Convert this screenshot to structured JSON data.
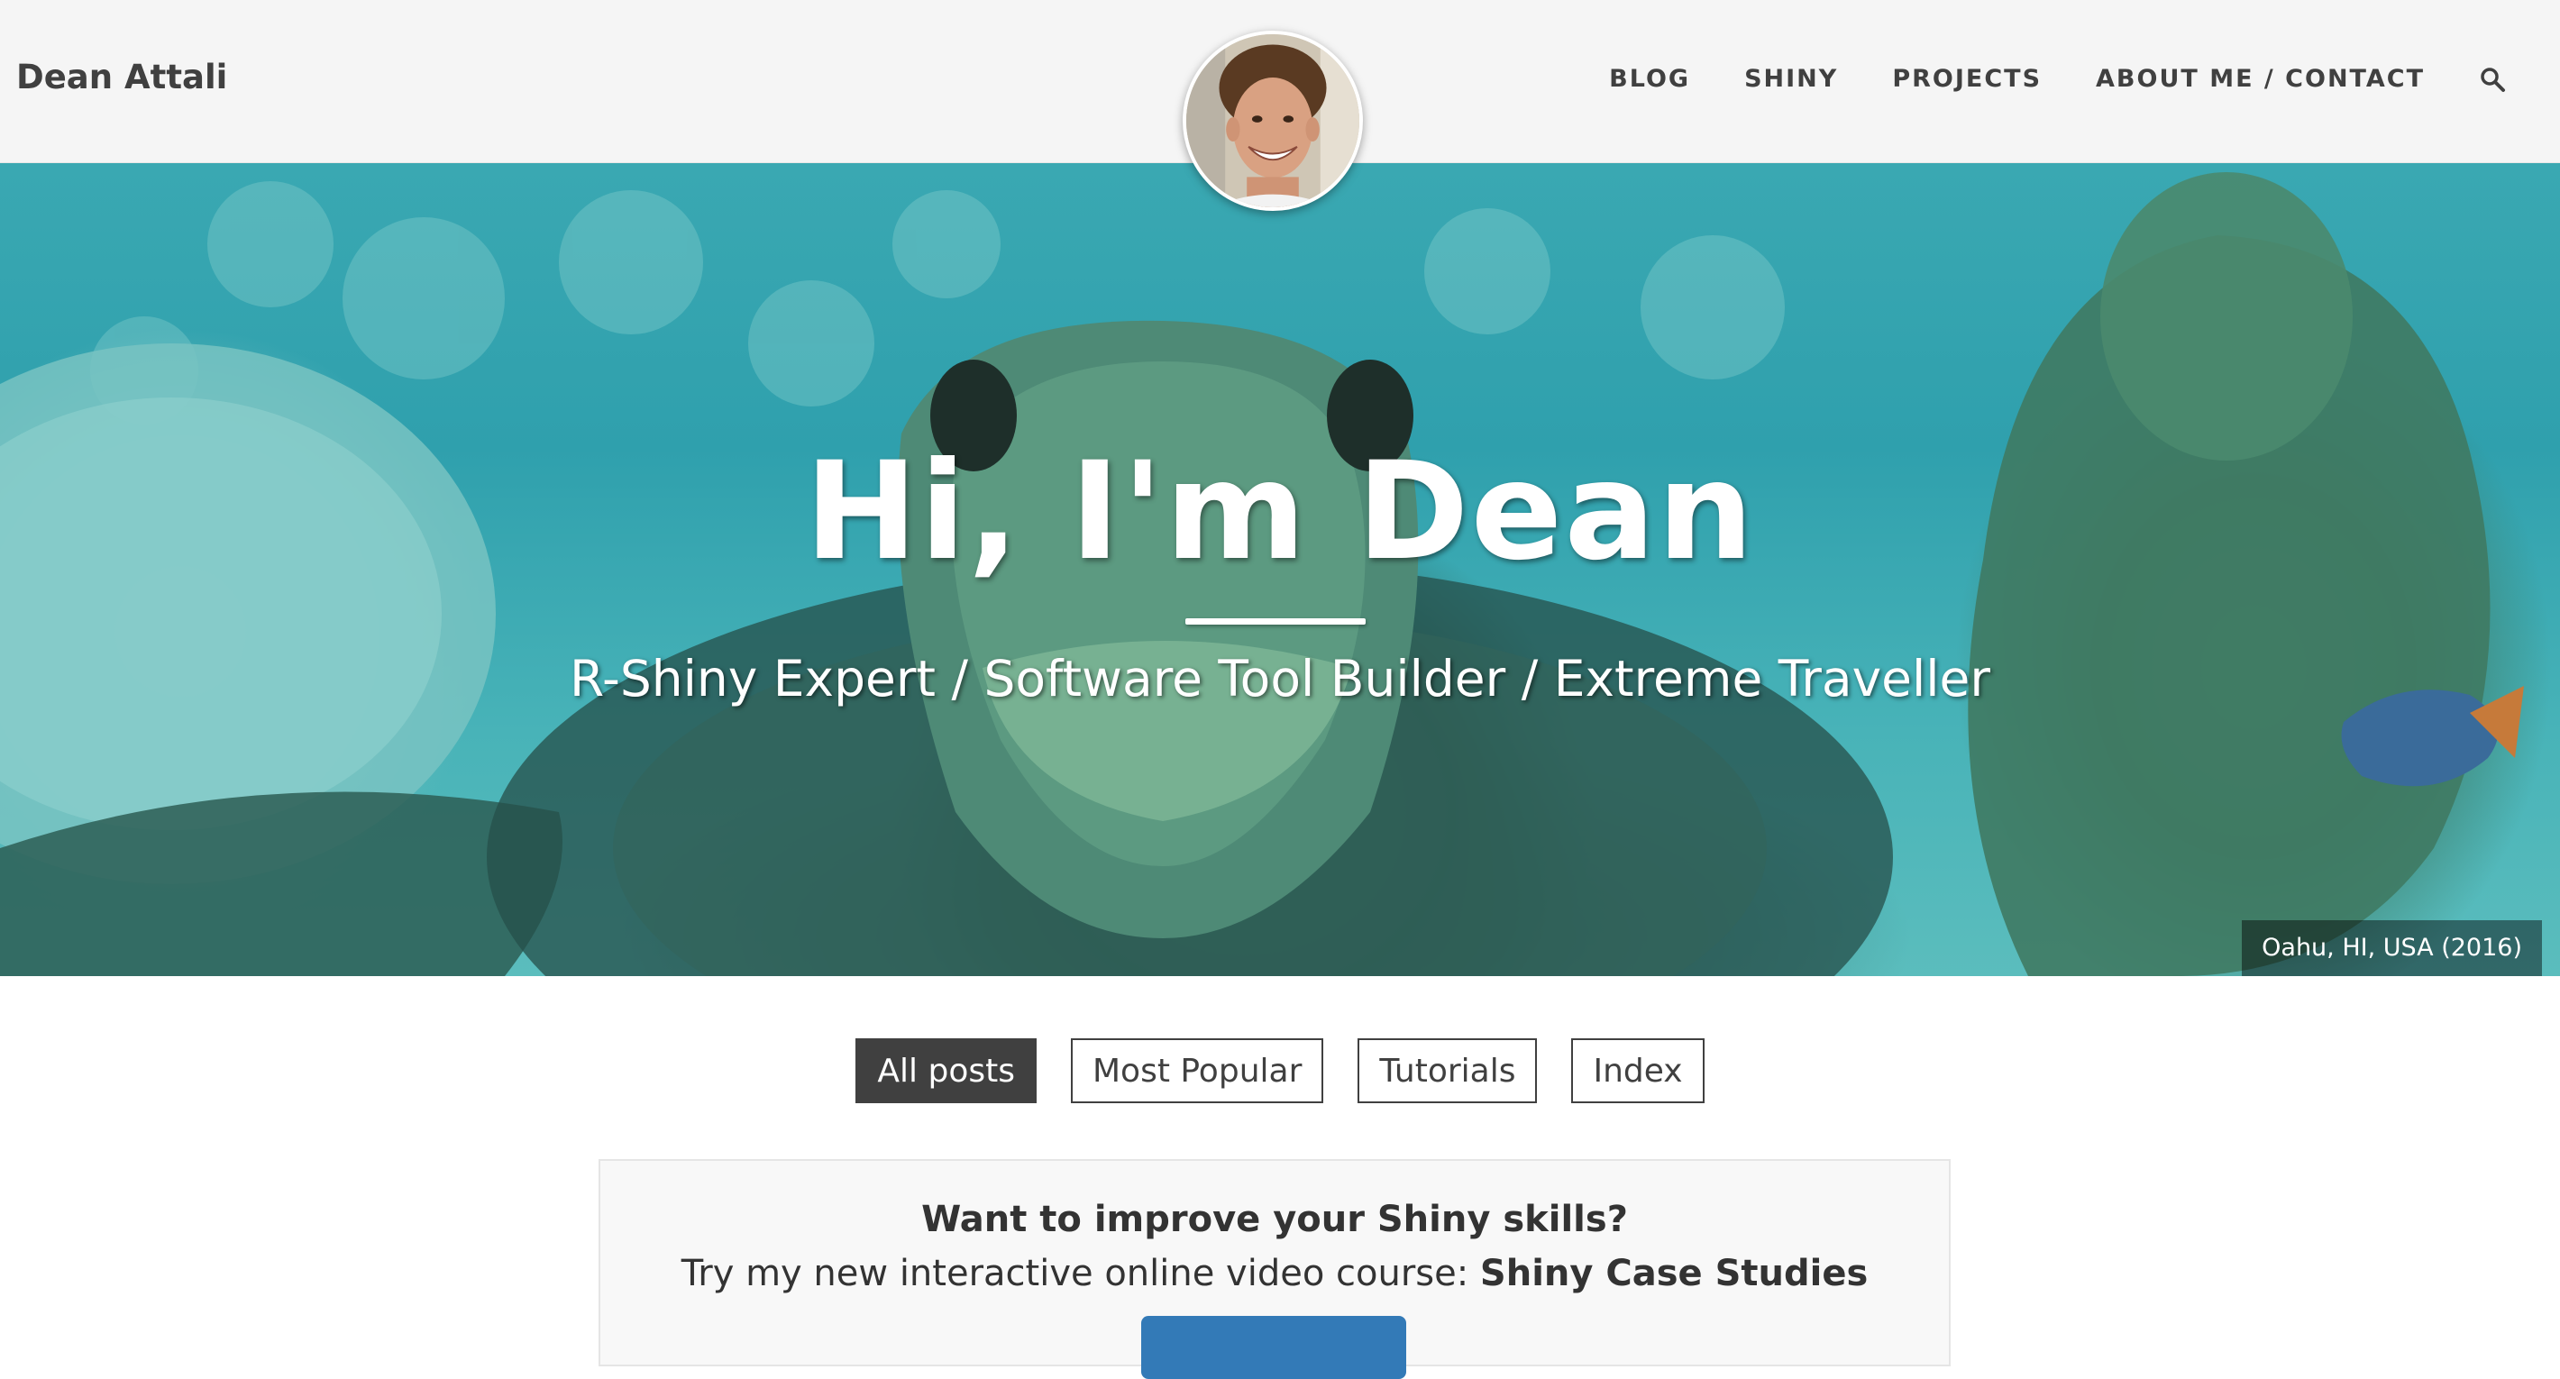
{
  "navbar": {
    "brand": "Dean Attali",
    "links": [
      "BLOG",
      "SHINY",
      "PROJECTS",
      "ABOUT ME / CONTACT"
    ],
    "search_icon": "search-icon"
  },
  "hero": {
    "title": "Hi, I'm Dean",
    "subtitle": "R-Shiny Expert / Software Tool Builder / Extreme Traveller",
    "caption": "Oahu, HI, USA (2016)"
  },
  "filters": {
    "items": [
      "All posts",
      "Most Popular",
      "Tutorials",
      "Index"
    ],
    "active": "All posts"
  },
  "promo": {
    "heading": "Want to improve your Shiny skills?",
    "line_prefix": "Try my new interactive online video course: ",
    "course_name": "Shiny Case Studies"
  },
  "colors": {
    "navbar_bg": "#f5f5f5",
    "text_dark": "#404040",
    "promo_button": "#337ab7"
  }
}
